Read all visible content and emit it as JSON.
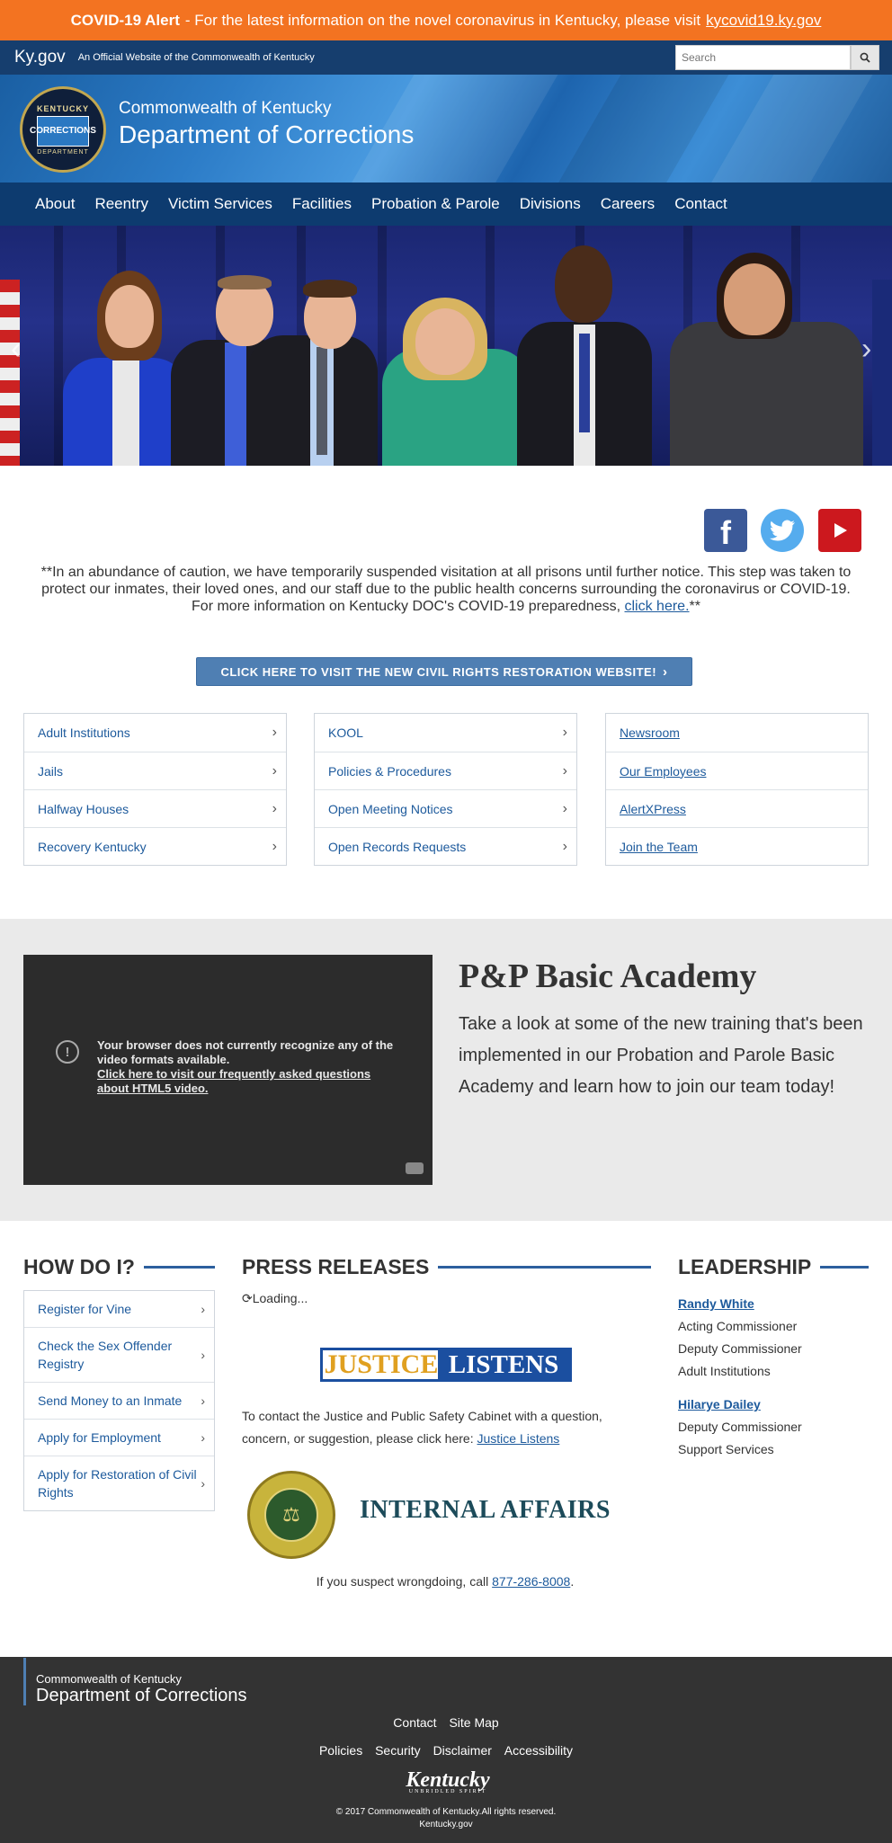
{
  "alert": {
    "title": "COVID-19 Alert",
    "text": "- For the latest information on the novel coronavirus in Kentucky, please visit",
    "link": "kycovid19.ky.gov"
  },
  "kygov": {
    "logo": "Ky.gov",
    "subtitle": "An Official Website of the Commonwealth of Kentucky",
    "search_placeholder": "Search",
    "search_icon": "search-icon"
  },
  "header": {
    "seal_top": "KENTUCKY",
    "seal_center": "CORRECTIONS",
    "seal_bottom": "DEPARTMENT",
    "line1": "Commonwealth of Kentucky",
    "line2": "Department of Corrections"
  },
  "nav": [
    "About",
    "Reentry",
    "Victim Services",
    "Facilities",
    "Probation & Parole",
    "Divisions",
    "Careers",
    "Contact"
  ],
  "hero": {
    "prev": "‹",
    "next": "›"
  },
  "social": {
    "facebook": "f"
  },
  "notice": {
    "text": "**In an abundance of caution, we have temporarily suspended visitation at all prisons until further notice. This step was taken to protect our inmates, their loved ones, and our staff due to the public health concerns surrounding the coronavirus or COVID-19.  For more information on Kentucky DOC's COVID-19 preparedness,",
    "link": "click here.",
    "tail": "**"
  },
  "civil_rights_button": "CLICK HERE TO VISIT THE NEW CIVIL RIGHTS RESTORATION WEBSITE!",
  "quicklinks": {
    "col1": [
      "Adult Institutions",
      "Jails",
      "Halfway Houses",
      "Recovery Kentucky"
    ],
    "col2": [
      "KOOL",
      "Policies & Procedures",
      "Open Meeting Notices",
      "Open Records Requests"
    ],
    "col3": [
      "Newsroom",
      "Our Employees",
      "AlertXPress",
      "Join the Team"
    ]
  },
  "academy": {
    "video_message": "Your browser does not currently recognize any of the video formats available.",
    "video_link": "Click here to visit our frequently asked questions about HTML5 video.",
    "title": "P&P Basic Academy",
    "description": "Take a look at some of the new training that's been implemented in our Probation and Parole Basic Academy and learn how to join our team today!"
  },
  "how_do_i": {
    "heading": "HOW DO I?",
    "items": [
      "Register for Vine",
      "Check the Sex Offender Registry",
      "Send Money to an Inmate",
      "Apply for Employment",
      "Apply for Restoration of Civil Rights"
    ]
  },
  "press": {
    "heading": "PRESS RELEASES",
    "loading": "Loading...",
    "justice_gold": "JUSTICE",
    "justice_blue": "LISTENS",
    "contact_text": "To contact the Justice and Public Safety Cabinet with a question, concern, or suggestion, please click here:",
    "contact_link": "Justice Listens",
    "ia_title": "INTERNAL AFFAIRS",
    "suspect_text": "If you suspect wrongdoing, call",
    "suspect_phone": "877-286-8008",
    "suspect_end": "."
  },
  "leadership": {
    "heading": "LEADERSHIP",
    "people": [
      {
        "name": "Randy White",
        "lines": [
          "Acting Commissioner",
          "Deputy Commissioner",
          "Adult Institutions"
        ]
      },
      {
        "name": "Hilarye Dailey",
        "lines": [
          "Deputy Commissioner",
          "Support Services"
        ]
      }
    ]
  },
  "footer": {
    "brand_top": "Commonwealth of Kentucky",
    "brand_bottom": "Department of Corrections",
    "links1": [
      "Contact",
      "Site Map"
    ],
    "links2": [
      "Policies",
      "Security",
      "Disclaimer",
      "Accessibility"
    ],
    "logo": "Kentucky",
    "logo_sub": "UNBRIDLED SPIRIT",
    "copyright": "© 2017 Commonwealth of Kentucky.All rights reserved.",
    "site": "Kentucky.gov"
  },
  "colors": {
    "alert": "#f37321",
    "kybar": "#163e6e",
    "nav": "#0d3b6f",
    "link": "#1d5a9c",
    "footer": "#333333"
  }
}
